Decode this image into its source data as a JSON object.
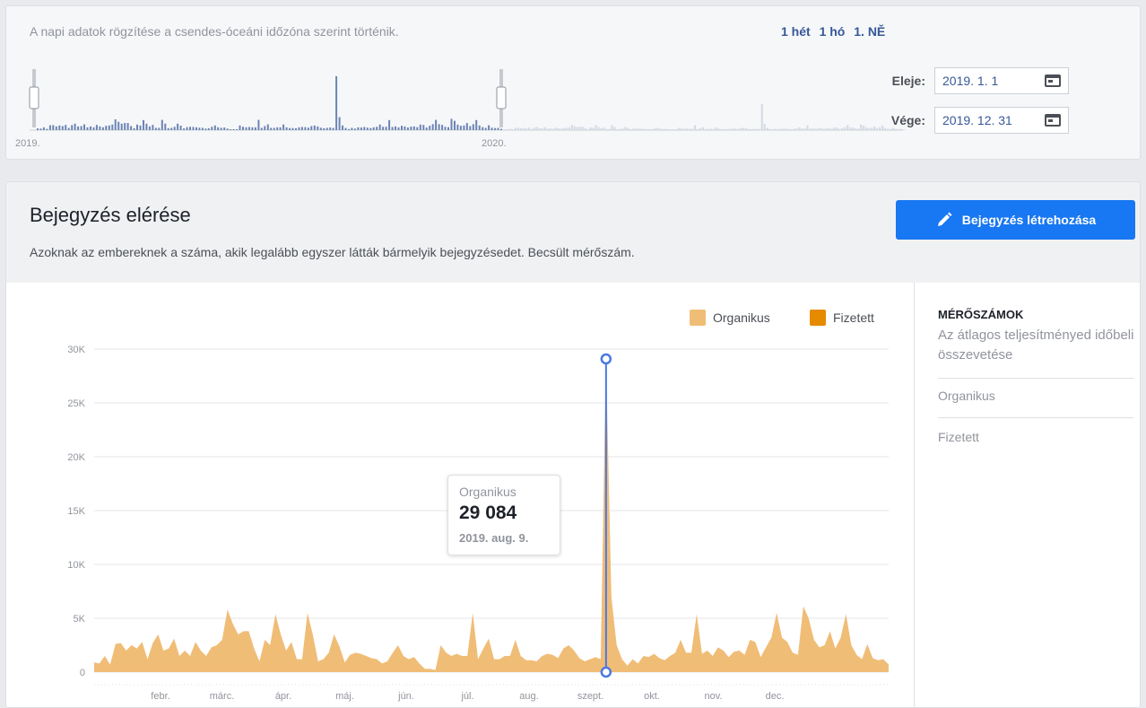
{
  "top": {
    "tz_note": "A napi adatok rögzítése a csendes-óceáni időzóna szerint történik.",
    "range_links": [
      "1 hét",
      "1 hó",
      "1. NĚ"
    ],
    "overview_labels": [
      "2019.",
      "2020."
    ],
    "start_label": "Eleje:",
    "start_value": "2019. 1. 1",
    "end_label": "Vége:",
    "end_value": "2019. 12. 31"
  },
  "main": {
    "title": "Bejegyzés elérése",
    "description": "Azoknak az embereknek a száma, akik legalább egyszer látták bármelyik bejegyzésedet. Becsült mérőszám.",
    "create_button": "Bejegyzés létrehozása",
    "legend": [
      {
        "name": "Organikus",
        "color": "#f0bd77"
      },
      {
        "name": "Fizetett",
        "color": "#e68a00"
      }
    ],
    "tooltip": {
      "title": "Organikus",
      "value": "29 084",
      "date": "2019. aug. 9."
    },
    "side": {
      "heading": "MÉRŐSZÁMOK",
      "subtitle": "Az átlagos teljesítményed időbeli összevetése",
      "items": [
        "Organikus",
        "Fizetett"
      ]
    }
  },
  "chart_data": {
    "type": "area",
    "title": "",
    "ylim": [
      0,
      30000
    ],
    "y_ticks": [
      "0",
      "5K",
      "10K",
      "15K",
      "20K",
      "25K",
      "30K"
    ],
    "x_ticks": [
      "febr.",
      "márc.",
      "ápr.",
      "máj.",
      "jún.",
      "júl.",
      "aug.",
      "szept.",
      "okt.",
      "nov.",
      "dec."
    ],
    "legend_position": "top-right",
    "grid": true,
    "series": [
      {
        "name": "Organikus",
        "color": "#f0bd77",
        "values": [
          900,
          800,
          1500,
          700,
          2600,
          2700,
          2000,
          2500,
          2200,
          2800,
          1200,
          2700,
          3500,
          2000,
          2200,
          3100,
          1500,
          2000,
          1500,
          2800,
          2000,
          1500,
          2300,
          2500,
          3000,
          5800,
          4500,
          3500,
          3800,
          3800,
          2200,
          1000,
          3000,
          2500,
          5400,
          3500,
          2000,
          2800,
          1200,
          1200,
          5500,
          3500,
          1000,
          1200,
          1800,
          3500,
          2400,
          900,
          1600,
          1800,
          1700,
          1500,
          1300,
          1200,
          800,
          1000,
          1800,
          2500,
          1500,
          1200,
          1400,
          800,
          300,
          300,
          200,
          2500,
          1800,
          1500,
          1700,
          1500,
          1500,
          5500,
          1200,
          2200,
          3100,
          1200,
          1200,
          1500,
          1500,
          3000,
          1500,
          1100,
          1100,
          1000,
          1500,
          1700,
          1600,
          1300,
          2200,
          2500,
          2000,
          1300,
          1000,
          1200,
          1400,
          1200,
          29084,
          7000,
          2500,
          1200,
          600,
          1200,
          800,
          1500,
          1400,
          1700,
          1300,
          1100,
          1500,
          1800,
          3000,
          1800,
          1800,
          5400,
          1700,
          2000,
          1500,
          2300,
          2000,
          1400,
          1900,
          2000,
          1600,
          3000,
          2800,
          1400,
          2300,
          3200,
          5500,
          3200,
          2800,
          1800,
          1600,
          6100,
          5000,
          3000,
          2300,
          2500,
          3800,
          2200,
          3200,
          5400,
          2500,
          1600,
          1200,
          2600,
          1300,
          1100,
          1200,
          700
        ],
        "highlight": {
          "date": "2019. aug. 9.",
          "value": 29084
        }
      },
      {
        "name": "Fizetett",
        "color": "#e68a00",
        "values": []
      }
    ]
  }
}
